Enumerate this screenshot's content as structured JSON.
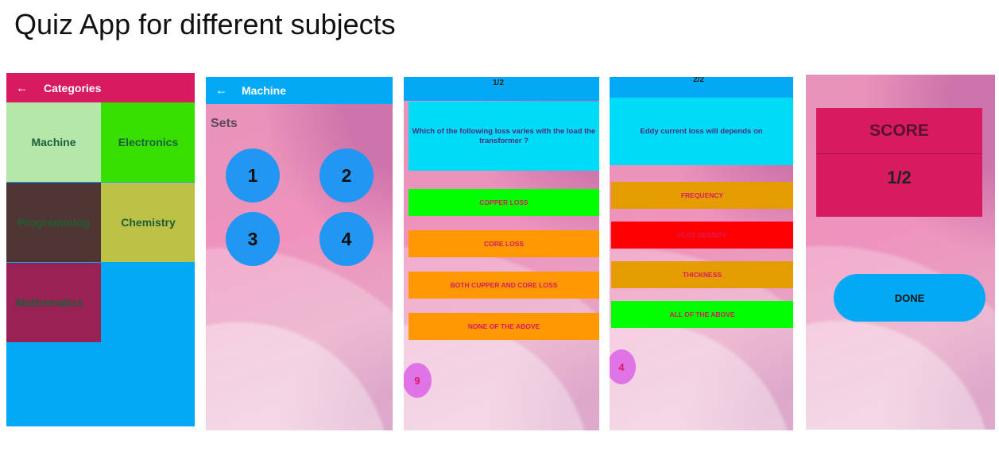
{
  "page_title": "Quiz App for different subjects",
  "categories_screen": {
    "title": "Categories",
    "back_icon": "arrow-left-icon",
    "tiles": [
      {
        "label": "Machine",
        "bg": "#b5e7a8",
        "color": "#1b5e3c"
      },
      {
        "label": "Electronics",
        "bg": "#38e000",
        "color": "#1b5e3c"
      },
      {
        "label": "Programming",
        "bg": "#503535",
        "color": "#1f5e2c"
      },
      {
        "label": "Chemistry",
        "bg": "#bdc145",
        "color": "#1b5e3c"
      },
      {
        "label": "Mathematics",
        "bg": "#9a2153",
        "color": "#1b5e3c"
      }
    ]
  },
  "sets_screen": {
    "title": "Machine",
    "back_icon": "arrow-left-icon",
    "sets_label": "Sets",
    "sets": [
      "1",
      "2",
      "3",
      "4"
    ]
  },
  "question_screen_1": {
    "progress": "1/2",
    "question": "Which of the following loss varies with the load the transformer ?",
    "options": [
      {
        "label": "COPPER LOSS",
        "bg": "#00ff00"
      },
      {
        "label": "CORE LOSS",
        "bg": "#ff9800"
      },
      {
        "label": "BOTH CUPPER AND CORE LOSS",
        "bg": "#ff9800"
      },
      {
        "label": "NONE OF THE ABOVE",
        "bg": "#ff9800"
      }
    ],
    "timer": "9"
  },
  "question_screen_2": {
    "progress": "2/2",
    "question": "Eddy current loss will depends on",
    "options": [
      {
        "label": "FREQUENCY",
        "bg": "#e59c00"
      },
      {
        "label": "FLUX DENSITY",
        "bg": "#ff0000"
      },
      {
        "label": "THICKNESS",
        "bg": "#e59c00"
      },
      {
        "label": "ALL OF THE ABOVE",
        "bg": "#00ff00"
      }
    ],
    "timer": "4"
  },
  "score_screen": {
    "score_label": "SCORE",
    "score_value": "1/2",
    "done_label": "DONE"
  },
  "colors": {
    "primary_blue": "#03a9f4",
    "accent_pink": "#d81b60",
    "question_cyan": "#00dbf8"
  }
}
